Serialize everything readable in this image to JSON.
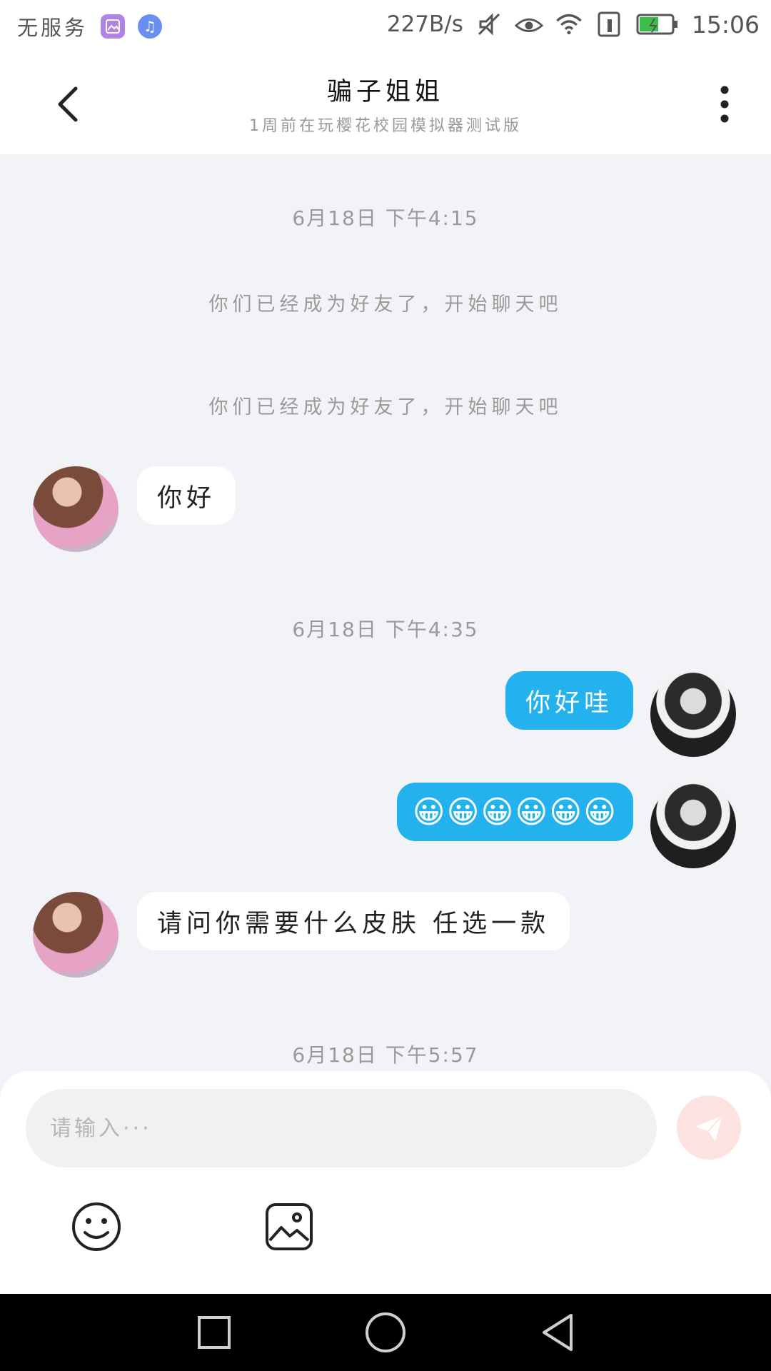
{
  "status_bar": {
    "carrier": "无服务",
    "net_speed": "227B/s",
    "time": "15:06"
  },
  "header": {
    "title": "骗子姐姐",
    "subtitle": "1周前在玩樱花校园模拟器测试版"
  },
  "messages": {
    "time1": "6月18日 下午4:15",
    "system1": "你们已经成为好友了，开始聊天吧",
    "system2": "你们已经成为好友了，开始聊天吧",
    "msg1": "你好",
    "time2": "6月18日 下午4:35",
    "msg2": "你好哇",
    "msg3": "😀😀😀😀😀😀",
    "msg4": "请问你需要什么皮肤 任选一款",
    "time3": "6月18日 下午5:57"
  },
  "composer": {
    "placeholder": "请输入···"
  },
  "colors": {
    "accent": "#24b2ef",
    "send_button": "#fde3df",
    "background": "#f2f3f7"
  },
  "icons": {
    "back": "chevron-left-icon",
    "more": "more-vertical-icon",
    "send": "paper-plane-icon",
    "emoji": "smiley-icon",
    "image": "image-icon",
    "nav_recent": "square-icon",
    "nav_home": "circle-icon",
    "nav_back": "triangle-back-icon"
  }
}
